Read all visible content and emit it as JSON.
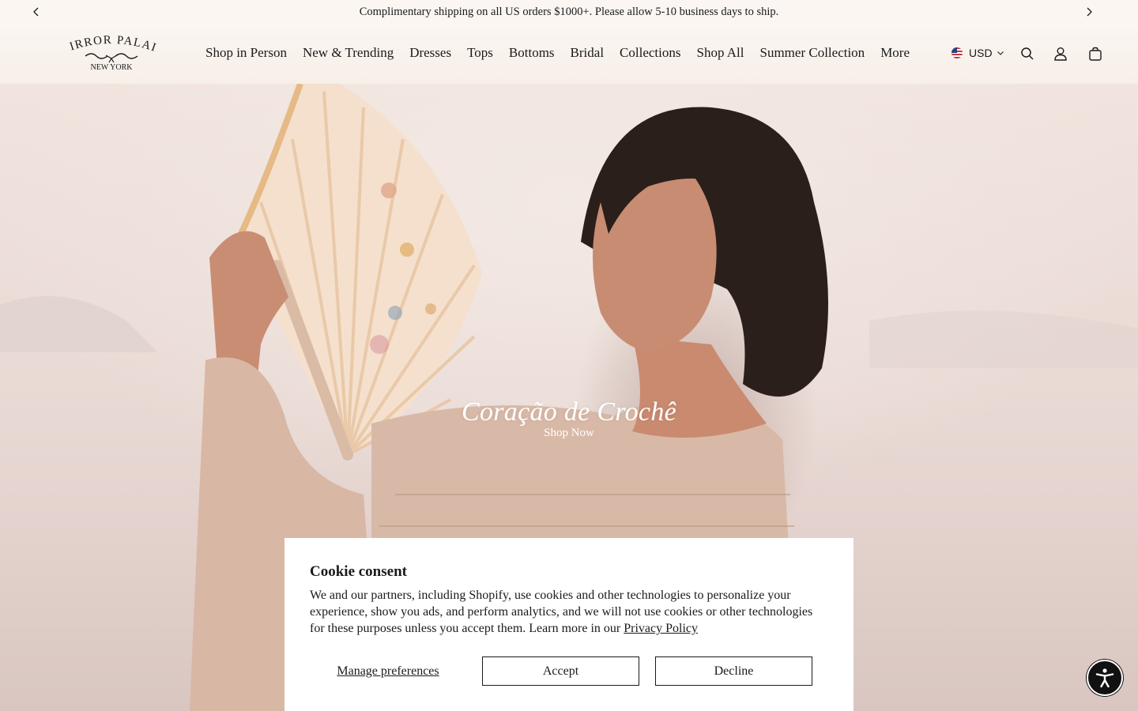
{
  "announcement": {
    "text": "Complimentary shipping on all US orders $1000+. Please allow 5-10 business days to ship.",
    "prev_icon": "chevron-left-icon",
    "next_icon": "chevron-right-icon"
  },
  "brand": {
    "name_top": "MIRROR PALAIS",
    "name_bottom": "NEW YORK"
  },
  "nav": {
    "items": [
      {
        "label": "Shop in Person"
      },
      {
        "label": "New & Trending"
      },
      {
        "label": "Dresses"
      },
      {
        "label": "Tops"
      },
      {
        "label": "Bottoms"
      },
      {
        "label": "Bridal"
      },
      {
        "label": "Collections"
      },
      {
        "label": "Shop All"
      },
      {
        "label": "Summer Collection"
      },
      {
        "label": "More"
      }
    ]
  },
  "header_tools": {
    "currency": "USD",
    "icons": [
      "us-flag-icon",
      "search-icon",
      "account-icon",
      "cart-icon"
    ]
  },
  "hero": {
    "title": "Coração de Crochê",
    "link": "Shop Now"
  },
  "cookie": {
    "title": "Cookie consent",
    "body": "We and our partners, including Shopify, use cookies and other technologies to personalize your experience, show you ads, and perform analytics, and we will not use cookies or other technologies for these purposes unless you accept them. Learn more in our ",
    "policy_link": "Privacy Policy",
    "manage_label": "Manage preferences",
    "accept_label": "Accept",
    "decline_label": "Decline"
  },
  "accessibility": {
    "icon": "accessibility-icon"
  },
  "colors": {
    "text": "#1a1a1a",
    "announcement_bg": "#fbf6f1",
    "hero_text": "#ffffff",
    "a11y_bg": "#111111"
  }
}
